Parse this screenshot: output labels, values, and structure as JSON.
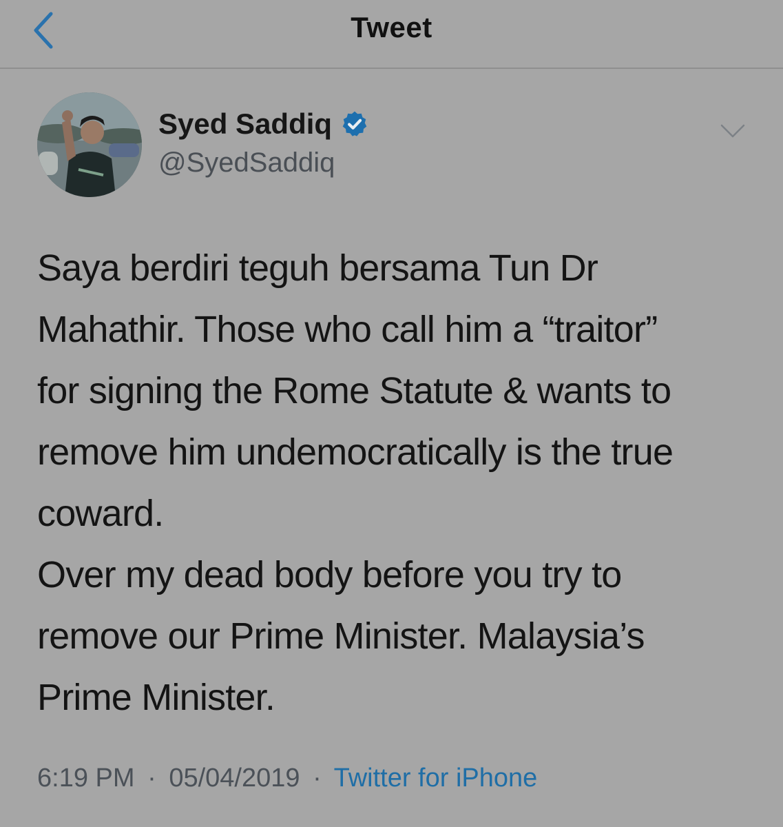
{
  "nav": {
    "title": "Tweet",
    "back_icon": "chevron-left-icon"
  },
  "author": {
    "display_name": "Syed Saddiq",
    "handle": "@SyedSaddiq",
    "verified": true
  },
  "tweet": {
    "lines": [
      "Saya berdiri teguh bersama Tun Dr",
      "Mahathir. Those who call him a “traitor”",
      "for signing the Rome Statute  & wants to",
      "remove him undemocratically is the true",
      "coward.",
      "Over my dead body before you try to",
      "remove our Prime Minister. Malaysia’s",
      "Prime Minister."
    ]
  },
  "meta": {
    "time": "6:19 PM",
    "date": "05/04/2019",
    "separator": "·",
    "source": "Twitter for iPhone"
  },
  "colors": {
    "background": "#a6a6a6",
    "accent": "#1f6ea6",
    "verified_badge": "#1d6fae"
  }
}
